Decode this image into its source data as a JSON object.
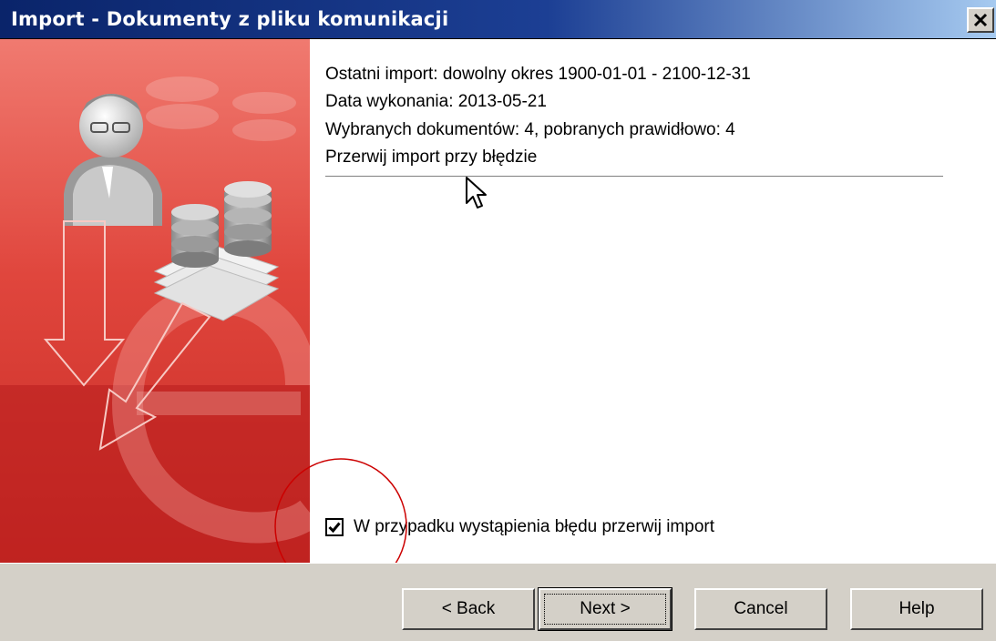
{
  "window": {
    "title": "Import - Dokumenty z pliku komunikacji",
    "close_glyph": "✕"
  },
  "info": {
    "last_import": "Ostatni import: dowolny okres 1900-01-01 - 2100-12-31",
    "execution_date": "Data wykonania: 2013-05-21",
    "documents": "Wybranych dokumentów: 4, pobranych prawidłowo: 4",
    "stop_on_error": "Przerwij import przy błędzie"
  },
  "options": {
    "stop_on_error_checkbox": {
      "label": "W przypadku wystąpienia błędu przerwij import",
      "checked": true
    }
  },
  "buttons": {
    "back": "< Back",
    "next": "Next >",
    "cancel": "Cancel",
    "help": "Help"
  },
  "colors": {
    "title_bar": "#0a246a",
    "side_panel": "#d9382f",
    "dialog_face": "#d4d0c8",
    "annotation": "#cc0000"
  },
  "icons": {
    "user": "user-icon",
    "database": "database-icon",
    "arrow": "arrow-down-icon",
    "cursor": "mouse-cursor-icon"
  }
}
